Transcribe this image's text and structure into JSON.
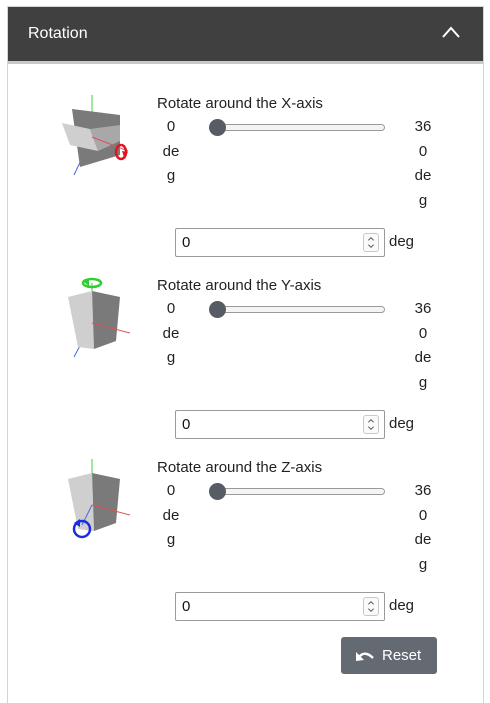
{
  "panel": {
    "title": "Rotation"
  },
  "rotations": [
    {
      "axis": "x",
      "label": "Rotate around the X-axis",
      "min_lines": [
        "0",
        "de",
        "g"
      ],
      "max_lines": [
        "36",
        "0",
        "de",
        "g"
      ],
      "value": "0",
      "slider_fraction": 0,
      "unit": "deg",
      "ring_color": "#e0141e",
      "illustration_icon": "rotate-x-axis-icon"
    },
    {
      "axis": "y",
      "label": "Rotate around the Y-axis",
      "min_lines": [
        "0",
        "de",
        "g"
      ],
      "max_lines": [
        "36",
        "0",
        "de",
        "g"
      ],
      "value": "0",
      "slider_fraction": 0,
      "unit": "deg",
      "ring_color": "#2ecf2e",
      "illustration_icon": "rotate-y-axis-icon"
    },
    {
      "axis": "z",
      "label": "Rotate around the Z-axis",
      "min_lines": [
        "0",
        "de",
        "g"
      ],
      "max_lines": [
        "36",
        "0",
        "de",
        "g"
      ],
      "value": "0",
      "slider_fraction": 0,
      "unit": "deg",
      "ring_color": "#1a2ee0",
      "illustration_icon": "rotate-z-axis-icon"
    }
  ],
  "reset": {
    "label": "Reset",
    "icon": "undo-icon"
  },
  "colors": {
    "header_bg": "#404040",
    "header_text": "#ffffff",
    "slider_thumb": "#565b64",
    "button_bg": "#646a72"
  }
}
